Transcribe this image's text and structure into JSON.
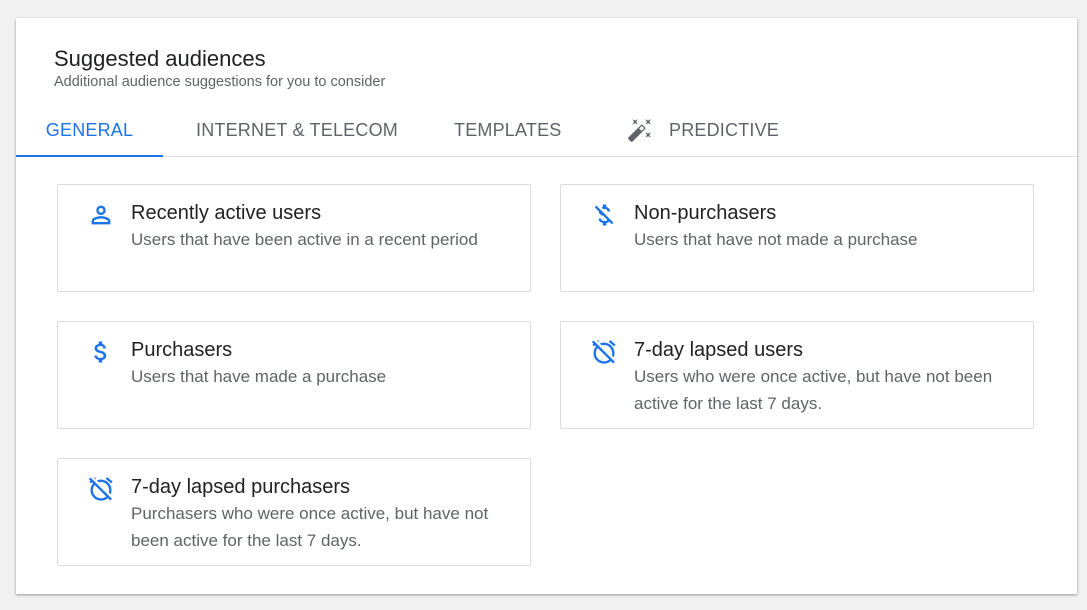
{
  "header": {
    "title": "Suggested audiences",
    "subtitle": "Additional audience suggestions for you to consider"
  },
  "tabs": [
    {
      "label": "GENERAL",
      "active": true
    },
    {
      "label": "INTERNET & TELECOM",
      "active": false
    },
    {
      "label": "TEMPLATES",
      "active": false
    },
    {
      "label": "PREDICTIVE",
      "active": false,
      "icon": "magic-wand-icon"
    }
  ],
  "cards": [
    {
      "name": "Recently active users",
      "description": "Users that have been active in a recent period",
      "icon": "person-icon"
    },
    {
      "name": "Non-purchasers",
      "description": "Users that have not made a purchase",
      "icon": "money-off-icon"
    },
    {
      "name": "Purchasers",
      "description": "Users that have made a purchase",
      "icon": "dollar-icon"
    },
    {
      "name": "7-day lapsed users",
      "description": "Users who were once active, but have not been active for the last 7 days.",
      "icon": "alarm-off-icon"
    },
    {
      "name": "7-day lapsed purchasers",
      "description": "Purchasers who were once active, but have not been active for the last 7 days.",
      "icon": "alarm-off-icon"
    }
  ],
  "colors": {
    "accent": "#1a73e8",
    "text_primary": "#202124",
    "text_secondary": "#5f6368",
    "border": "#dadce0"
  }
}
